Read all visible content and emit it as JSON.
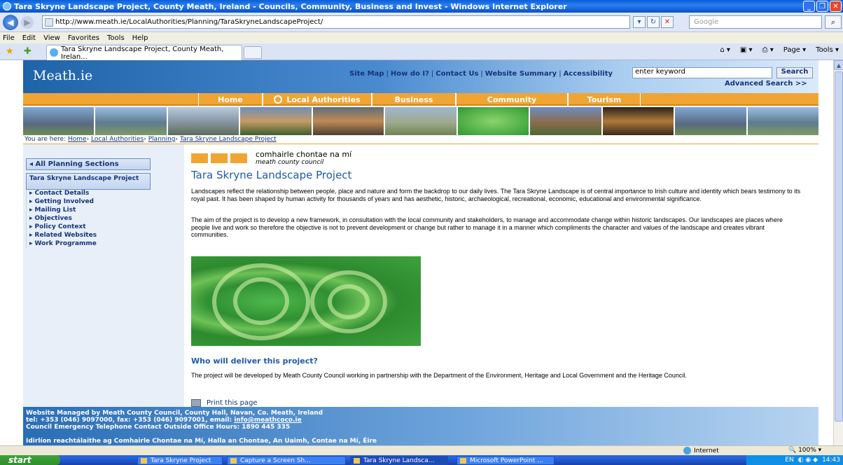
{
  "window": {
    "title": "Tara Skryne Landscape Project, County Meath, Ireland - Councils, Community, Business and Invest - Windows Internet Explorer"
  },
  "address": {
    "url": "http://www.meath.ie/LocalAuthorities/Planning/TaraSkryneLandscapeProject/",
    "search_placeholder": "Google"
  },
  "menu": [
    "File",
    "Edit",
    "View",
    "Favorites",
    "Tools",
    "Help"
  ],
  "tabs": {
    "active_label": "Tara Skryne Landscape Project, County Meath, Irelan...",
    "page_label": "Page",
    "tools_label": "Tools"
  },
  "site": {
    "logo": "Meath.ie",
    "top_links": [
      "Site Map",
      "How do I?",
      "Contact Us",
      "Website Summary",
      "Accessibility"
    ],
    "keyword_value": "enter keyword",
    "search_label": "Search",
    "advanced_search": "Advanced Search >>",
    "nav": [
      "Home",
      "Local Authorities",
      "Business",
      "Community",
      "Tourism"
    ],
    "breadcrumb": {
      "prefix": "You are here:",
      "items": [
        "Home",
        "Local Authorities",
        "Planning",
        "Tara Skryne Landscape Project"
      ]
    },
    "left_nav": {
      "all_sections": "All Planning Sections",
      "section_title": "Tara Skryne Landscape Project",
      "items": [
        "Contact Details",
        "Getting Involved",
        "Mailing List",
        "Objectives",
        "Policy Context",
        "Related Websites",
        "Work Programme"
      ]
    },
    "council": {
      "irish": "comhairle chontae na mí",
      "english": "meath county council"
    },
    "content": {
      "title": "Tara Skryne Landscape Project",
      "para1": "Landscapes reflect the relationship between people, place and nature and form the backdrop to our daily lives.  The Tara Skryne Landscape is of central importance to Irish culture and identity which bears testimony to its royal past.  It has been shaped by human activity for thousands of years and has aesthetic, historic, archaeological, recreational, economic, educational and environmental significance.",
      "para2": "The aim of the project is to develop a new framework, in consultation with the local community and stakeholders, to manage and accommodate change within historic landscapes.  Our landscapes are places where people live and work so therefore the objective is not to prevent development or change but rather to manage it in a manner which compliments the character and values of the landscape and creates vibrant communities.",
      "subheading": "Who will deliver this project?",
      "para3": "The project will be developed by Meath County Council working in partnership with the Department of the Environment, Heritage and Local Government and the Heritage Council.",
      "print_label": "Print this page"
    },
    "footer": {
      "line1": "Website Managed by Meath County Council, County Hall, Navan, Co. Meath, Ireland",
      "line2_prefix": "tel: +353 (046) 9097000, fax: +353 (046) 9097001, email: ",
      "email": "info@meathcoco.ie",
      "line3": "Council Emergency Telephone Contact Outside Office Hours: 1890 445 335",
      "irish": "Idirlíon reachtálaithe ag Comhairle Chontae na Mí, Halla an Chontae, An Uaimh, Contae na Mí, Éire"
    }
  },
  "status": {
    "zone": "Internet",
    "zoom": "100%"
  },
  "taskbar": {
    "start": "start",
    "items": [
      "Tara Skryne Project",
      "Capture a Screen Sh...",
      "Tara Skryne Landsca...",
      "Microsoft PowerPoint ..."
    ],
    "lang": "EN",
    "clock": "14:43"
  }
}
